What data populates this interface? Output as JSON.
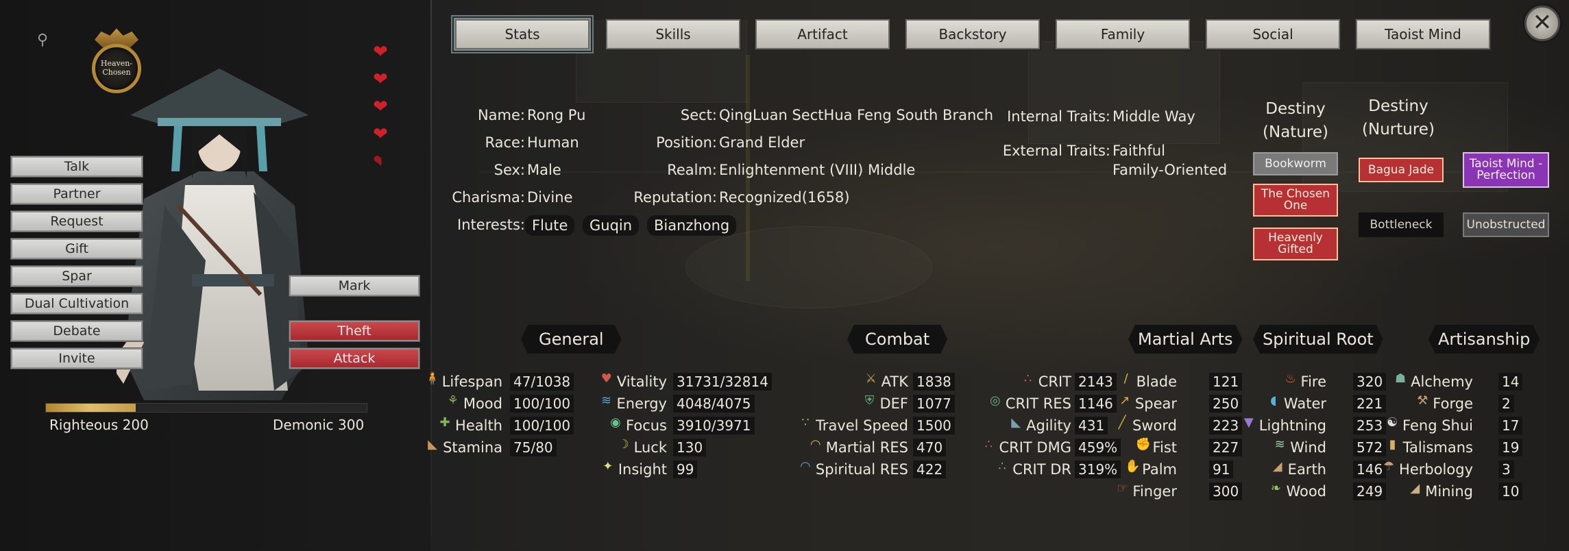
{
  "tabs": [
    {
      "label": "Stats",
      "active": true
    },
    {
      "label": "Skills"
    },
    {
      "label": "Artifact"
    },
    {
      "label": "Backstory"
    },
    {
      "label": "Family"
    },
    {
      "label": "Social"
    },
    {
      "label": "Taoist Mind"
    }
  ],
  "close_icon": "close-x-icon",
  "left_panel": {
    "search_icon": "magnifier-icon",
    "emblem_text": "Heaven-Chosen",
    "hearts": {
      "full": 4,
      "half": 1
    },
    "actions": [
      "Talk",
      "Partner",
      "Request",
      "Gift",
      "Spar",
      "Dual Cultivation",
      "Debate",
      "Invite"
    ],
    "mark_label": "Mark",
    "theft_label": "Theft",
    "attack_label": "Attack",
    "alignment": {
      "righteous_label": "Righteous 200",
      "demonic_label": "Demonic 300",
      "righteous_fraction": 0.28
    }
  },
  "profile": {
    "name_label": "Name:",
    "name": "Rong Pu",
    "race_label": "Race:",
    "race": "Human",
    "sex_label": "Sex:",
    "sex": "Male",
    "charisma_label": "Charisma:",
    "charisma": "Divine",
    "interests_label": "Interests:",
    "interests": [
      "Flute",
      "Guqin",
      "Bianzhong"
    ],
    "sect_label": "Sect:",
    "sect": "QingLuan SectHua Feng South Branch",
    "position_label": "Position:",
    "position": "Grand Elder",
    "realm_label": "Realm:",
    "realm": "Enlightenment (VIII) Middle",
    "reputation_label": "Reputation:",
    "reputation": "Recognized(1658)",
    "internal_label": "Internal Traits:",
    "internal": "Middle Way",
    "external_label": "External Traits:",
    "external_1": "Faithful",
    "external_2": "Family-Oriented"
  },
  "destiny": {
    "nature_head_1": "Destiny",
    "nature_head_2": "(Nature)",
    "nurture_head_1": "Destiny",
    "nurture_head_2": "(Nurture)",
    "nature_tags": [
      {
        "label": "Bookworm",
        "style": "grey"
      },
      {
        "label": "The Chosen One",
        "style": "red"
      },
      {
        "label": "Heavenly Gifted",
        "style": "red"
      }
    ],
    "nurture_tags": [
      {
        "label": "Bagua Jade",
        "style": "red"
      },
      {
        "label": "Taoist Mind - Perfection",
        "style": "purple"
      },
      {
        "label": "Bottleneck",
        "style": "dark"
      },
      {
        "label": "Unobstructed",
        "style": "slate"
      }
    ]
  },
  "sections": {
    "general": "General",
    "combat": "Combat",
    "martial": "Martial Arts",
    "root": "Spiritual Root",
    "artisan": "Artisanship"
  },
  "general": {
    "col1": [
      {
        "label": "Lifespan",
        "value": "47/1038",
        "icon": "person-icon",
        "color": "#c9a640"
      },
      {
        "label": "Mood",
        "value": "100/100",
        "icon": "sprout-icon",
        "color": "#86b35a"
      },
      {
        "label": "Health",
        "value": "100/100",
        "icon": "cross-icon",
        "color": "#7fb45a"
      },
      {
        "label": "Stamina",
        "value": "75/80",
        "icon": "boot-icon",
        "color": "#c9975a"
      }
    ],
    "col2": [
      {
        "label": "Vitality",
        "value": "31731/32814",
        "icon": "heart-icon",
        "color": "#d2584a"
      },
      {
        "label": "Energy",
        "value": "4048/4075",
        "icon": "energy-icon",
        "color": "#5aa0c8"
      },
      {
        "label": "Focus",
        "value": "3910/3971",
        "icon": "eye-icon",
        "color": "#67c18c"
      },
      {
        "label": "Luck",
        "value": "130",
        "icon": "moon-icon",
        "color": "#b8c24a"
      },
      {
        "label": "Insight",
        "value": "99",
        "icon": "star-icon",
        "color": "#dfe08a"
      }
    ]
  },
  "combat": {
    "col1": [
      {
        "label": "ATK",
        "value": "1838",
        "icon": "crossed-swords-icon",
        "color": "#d4a24a"
      },
      {
        "label": "DEF",
        "value": "1077",
        "icon": "shield-icon",
        "color": "#6ab07a"
      },
      {
        "label": "Travel Speed",
        "value": "1500",
        "icon": "footprints-icon",
        "color": "#d09a60"
      },
      {
        "label": "Martial RES",
        "value": "470",
        "icon": "dome-icon",
        "color": "#d8b050"
      },
      {
        "label": "Spiritual RES",
        "value": "422",
        "icon": "dome-icon",
        "color": "#6aa0d0"
      }
    ],
    "col2": [
      {
        "label": "CRIT",
        "value": "2143",
        "icon": "tri-blades-icon",
        "color": "#d06a4a"
      },
      {
        "label": "CRIT RES",
        "value": "1146",
        "icon": "ring-shield-icon",
        "color": "#6ab07a"
      },
      {
        "label": "Agility",
        "value": "431",
        "icon": "boot-icon",
        "color": "#7aa0b0"
      },
      {
        "label": "CRIT DMG",
        "value": "459%",
        "icon": "tri-dots-icon",
        "color": "#d05a4a"
      },
      {
        "label": "CRIT DR",
        "value": "319%",
        "icon": "tri-dots-icon",
        "color": "#6ab07a"
      }
    ]
  },
  "martial": [
    {
      "label": "Blade",
      "value": "121",
      "icon": "blade-icon",
      "color": "#d8b040"
    },
    {
      "label": "Spear",
      "value": "250",
      "icon": "spear-icon",
      "color": "#d8b040"
    },
    {
      "label": "Sword",
      "value": "223",
      "icon": "sword-icon",
      "color": "#d8b040"
    },
    {
      "label": "Fist",
      "value": "227",
      "icon": "fist-icon",
      "color": "#d8703a"
    },
    {
      "label": "Palm",
      "value": "91",
      "icon": "palm-icon",
      "color": "#d8703a"
    },
    {
      "label": "Finger",
      "value": "300",
      "icon": "finger-icon",
      "color": "#d8703a"
    }
  ],
  "root": [
    {
      "label": "Fire",
      "value": "320",
      "icon": "flame-icon",
      "color": "#e0603a"
    },
    {
      "label": "Water",
      "value": "221",
      "icon": "droplet-icon",
      "color": "#5ab0d8"
    },
    {
      "label": "Lightning",
      "value": "253",
      "icon": "lightning-icon",
      "color": "#9a7ad8"
    },
    {
      "label": "Wind",
      "value": "572",
      "icon": "wind-icon",
      "color": "#9ad0a0"
    },
    {
      "label": "Earth",
      "value": "146",
      "icon": "mountain-icon",
      "color": "#c8a070"
    },
    {
      "label": "Wood",
      "value": "249",
      "icon": "leaf-icon",
      "color": "#9ac060"
    }
  ],
  "artisan": [
    {
      "label": "Alchemy",
      "value": "14",
      "icon": "cauldron-icon",
      "color": "#7ab0a0"
    },
    {
      "label": "Forge",
      "value": "2",
      "icon": "hammer-icon",
      "color": "#c8a070"
    },
    {
      "label": "Feng Shui",
      "value": "17",
      "icon": "yin-yang-icon",
      "color": "#e0e0e0"
    },
    {
      "label": "Talismans",
      "value": "19",
      "icon": "talisman-icon",
      "color": "#d8b060"
    },
    {
      "label": "Herbology",
      "value": "3",
      "icon": "mushroom-icon",
      "color": "#c89a70"
    },
    {
      "label": "Mining",
      "value": "10",
      "icon": "ore-icon",
      "color": "#c8b080"
    }
  ]
}
